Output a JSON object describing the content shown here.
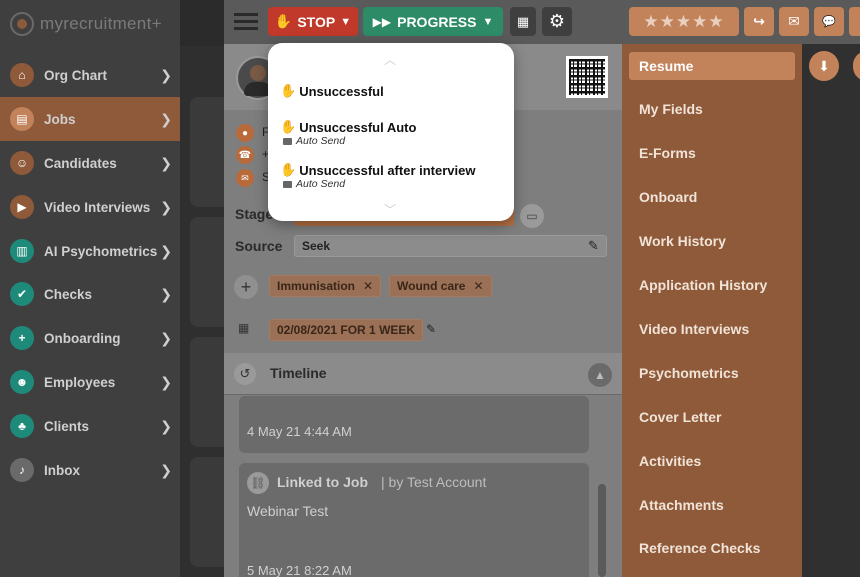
{
  "app": {
    "logo_text": "myrecruitment+"
  },
  "sidebar": {
    "items": [
      {
        "label": "Org Chart",
        "icon": "org-chart-icon",
        "color": "#8e5a39"
      },
      {
        "label": "Jobs",
        "icon": "jobs-icon",
        "color": "#c2825a",
        "active": true
      },
      {
        "label": "Candidates",
        "icon": "candidates-icon",
        "color": "#8e5a39"
      },
      {
        "label": "Video Interviews",
        "icon": "video-icon",
        "color": "#8e5a39"
      },
      {
        "label": "AI Psychometrics",
        "icon": "chart-icon",
        "color": "#1e8a7a"
      },
      {
        "label": "Checks",
        "icon": "check-icon",
        "color": "#1e8a7a"
      },
      {
        "label": "Onboarding",
        "icon": "add-user-icon",
        "color": "#1e8a7a"
      },
      {
        "label": "Employees",
        "icon": "employees-icon",
        "color": "#1e8a7a"
      },
      {
        "label": "Clients",
        "icon": "clients-icon",
        "color": "#1e8a7a"
      },
      {
        "label": "Inbox",
        "icon": "bell-icon",
        "color": "#6a6a6a"
      }
    ]
  },
  "topbar": {
    "stop_label": "STOP",
    "progress_label": "PROGRESS",
    "stars": "★★★★★",
    "colors": {
      "stop": "#c0392b",
      "progress": "#2e8b67",
      "accent": "#c2825a"
    }
  },
  "popup": {
    "items": [
      {
        "label": "Unsuccessful",
        "sub": ""
      },
      {
        "label": "Unsuccessful Auto",
        "sub": "Auto Send"
      },
      {
        "label": "Unsuccessful after interview",
        "sub": "Auto Send"
      }
    ]
  },
  "candidate": {
    "stage_label": "Stage",
    "source_label": "Source",
    "source_value": "Seek",
    "tags": [
      "Immunisation",
      "Wound care"
    ],
    "availability": "02/08/2021 FOR 1 WEEK",
    "contact_initials": [
      "F",
      "+",
      "S"
    ]
  },
  "timeline": {
    "title": "Timeline",
    "entries": [
      {
        "date": "4 May 21 4:44 AM"
      },
      {
        "heading": "Linked to Job",
        "by": "| by Test Account",
        "body": "Webinar Test",
        "date": "5 May 21 8:22 AM"
      }
    ]
  },
  "tabs": [
    "Resume",
    "My Fields",
    "E-Forms",
    "Onboard",
    "Work History",
    "Application History",
    "Video Interviews",
    "Psychometrics",
    "Cover Letter",
    "Activities",
    "Attachments",
    "Reference Checks"
  ]
}
